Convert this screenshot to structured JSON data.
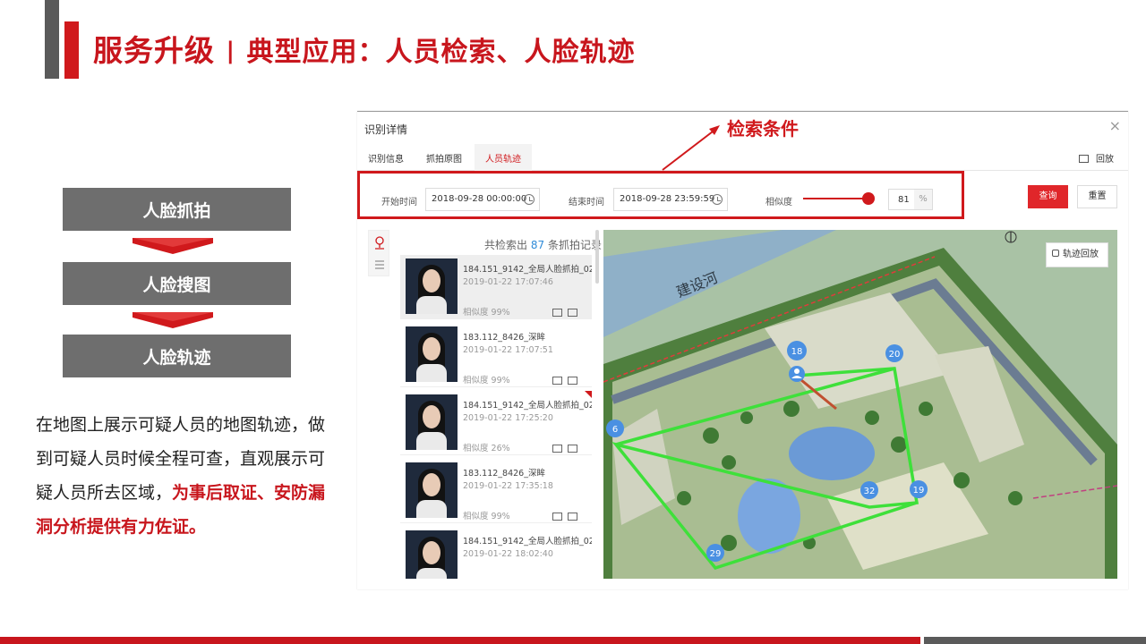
{
  "header": {
    "title_main": "服务升级",
    "title_sep": "|",
    "title_sub": "典型应用：人员检索、人脸轨迹"
  },
  "flow": [
    "人脸抓拍",
    "人脸搜图",
    "人脸轨迹"
  ],
  "description": {
    "normal": "在地图上展示可疑人员的地图轨迹，做到可疑人员时候全程可查，直观展示可疑人员所去区域，",
    "highlight": "为事后取证、安防漏洞分析提供有力佐证。"
  },
  "annotation": "检索条件",
  "dialog": {
    "title": "识别详情",
    "close": "×",
    "tabs": [
      "识别信息",
      "抓拍原图",
      "人员轨迹"
    ],
    "active_tab": "人员轨迹",
    "replay_top": "回放",
    "filter": {
      "start_label": "开始时间",
      "start_value": "2018-09-28 00:00:00",
      "end_label": "结束时间",
      "end_value": "2018-09-28 23:59:59",
      "similarity_label": "相似度",
      "similarity_value": "81",
      "similarity_unit": "%"
    },
    "buttons": {
      "query": "查询",
      "reset": "重置"
    },
    "results": {
      "prefix": "共检索出",
      "count": "87",
      "suffix": "条抓拍记录"
    },
    "cards": [
      {
        "id": "184.151_9142_全局人脸抓拍_02",
        "time": "2019-01-22 17:07:46",
        "sim": "相似度 99%"
      },
      {
        "id": "183.112_8426_深眸",
        "time": "2019-01-22 17:07:51",
        "sim": "相似度 99%"
      },
      {
        "id": "184.151_9142_全局人脸抓拍_02",
        "time": "2019-01-22 17:25:20",
        "sim": "相似度 26%"
      },
      {
        "id": "183.112_8426_深眸",
        "time": "2019-01-22 17:35:18",
        "sim": "相似度 99%"
      },
      {
        "id": "184.151_9142_全局人脸抓拍_02",
        "time": "2019-01-22 18:02:40",
        "sim": ""
      }
    ],
    "map": {
      "river_label": "建设河",
      "replay_button": "轨迹回放",
      "markers": [
        "18",
        "20",
        "6",
        "32",
        "19",
        "29"
      ]
    }
  },
  "colors": {
    "brand_red": "#c8161d",
    "track_green": "#3ee03a",
    "marker_blue": "#4a90e2"
  }
}
